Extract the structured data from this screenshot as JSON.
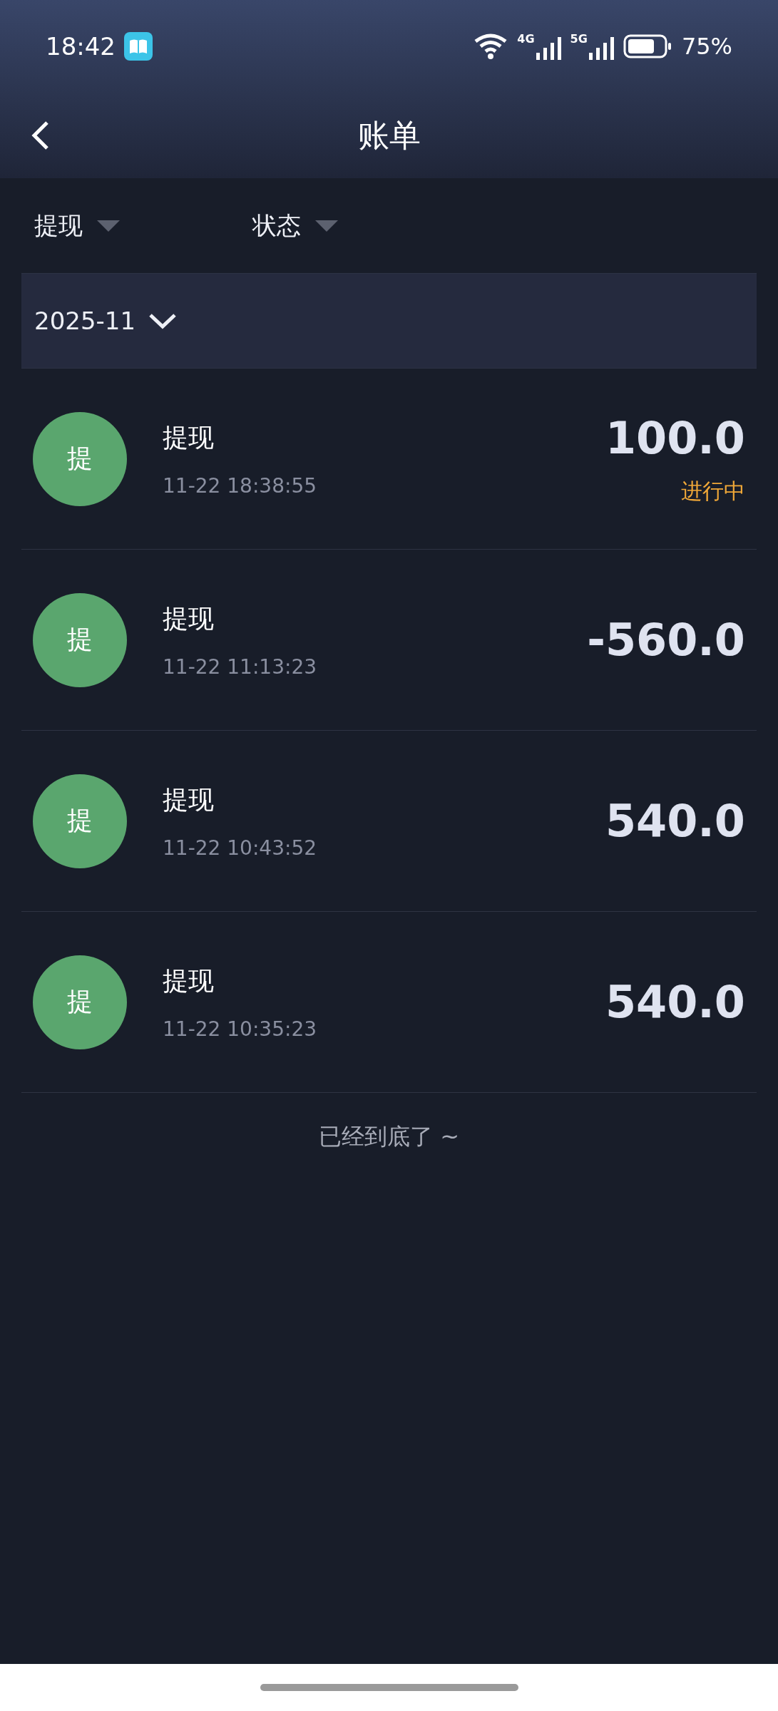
{
  "status_bar": {
    "time": "18:42",
    "networks": [
      "4G",
      "5G"
    ],
    "battery_text": "75%"
  },
  "header": {
    "title": "账单"
  },
  "filters": [
    {
      "label": "提现"
    },
    {
      "label": "状态"
    }
  ],
  "month": {
    "label": "2025-11"
  },
  "records": [
    {
      "avatar": "提",
      "title": "提现",
      "time": "11-22 18:38:55",
      "amount": "100.0",
      "status": "进行中"
    },
    {
      "avatar": "提",
      "title": "提现",
      "time": "11-22 11:13:23",
      "amount": "-560.0"
    },
    {
      "avatar": "提",
      "title": "提现",
      "time": "11-22 10:43:52",
      "amount": "540.0"
    },
    {
      "avatar": "提",
      "title": "提现",
      "time": "11-22 10:35:23",
      "amount": "540.0"
    }
  ],
  "footer": "已经到底了 ~"
}
